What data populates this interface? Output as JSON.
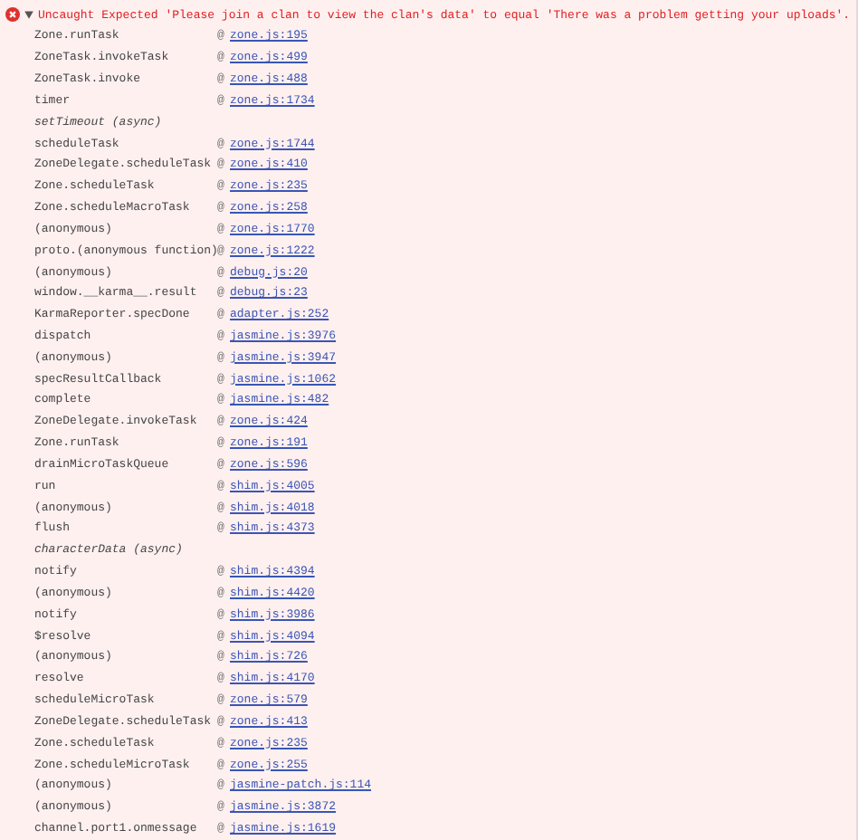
{
  "error": {
    "expanded": true,
    "message": "Uncaught Expected 'Please join a clan to view the clan's data' to equal 'There was a problem getting your uploads'.",
    "frames": [
      {
        "kind": "frame",
        "function": "Zone.runTask",
        "at": "@",
        "location": "zone.js:195"
      },
      {
        "kind": "frame",
        "function": "ZoneTask.invokeTask",
        "at": "@",
        "location": "zone.js:499"
      },
      {
        "kind": "frame",
        "function": "ZoneTask.invoke",
        "at": "@",
        "location": "zone.js:488"
      },
      {
        "kind": "frame",
        "function": "timer",
        "at": "@",
        "location": "zone.js:1734"
      },
      {
        "kind": "async",
        "label": "setTimeout (async)"
      },
      {
        "kind": "frame",
        "function": "scheduleTask",
        "at": "@",
        "location": "zone.js:1744"
      },
      {
        "kind": "frame",
        "function": "ZoneDelegate.scheduleTask",
        "at": "@",
        "location": "zone.js:410"
      },
      {
        "kind": "frame",
        "function": "Zone.scheduleTask",
        "at": "@",
        "location": "zone.js:235"
      },
      {
        "kind": "frame",
        "function": "Zone.scheduleMacroTask",
        "at": "@",
        "location": "zone.js:258"
      },
      {
        "kind": "frame",
        "function": "(anonymous)",
        "at": "@",
        "location": "zone.js:1770"
      },
      {
        "kind": "frame",
        "function": "proto.(anonymous function)",
        "at": "@",
        "location": "zone.js:1222"
      },
      {
        "kind": "frame",
        "function": "(anonymous)",
        "at": "@",
        "location": "debug.js:20"
      },
      {
        "kind": "frame",
        "function": "window.__karma__.result",
        "at": "@",
        "location": "debug.js:23"
      },
      {
        "kind": "frame",
        "function": "KarmaReporter.specDone",
        "at": "@",
        "location": "adapter.js:252"
      },
      {
        "kind": "frame",
        "function": "dispatch",
        "at": "@",
        "location": "jasmine.js:3976"
      },
      {
        "kind": "frame",
        "function": "(anonymous)",
        "at": "@",
        "location": "jasmine.js:3947"
      },
      {
        "kind": "frame",
        "function": "specResultCallback",
        "at": "@",
        "location": "jasmine.js:1062"
      },
      {
        "kind": "frame",
        "function": "complete",
        "at": "@",
        "location": "jasmine.js:482"
      },
      {
        "kind": "frame",
        "function": "ZoneDelegate.invokeTask",
        "at": "@",
        "location": "zone.js:424"
      },
      {
        "kind": "frame",
        "function": "Zone.runTask",
        "at": "@",
        "location": "zone.js:191"
      },
      {
        "kind": "frame",
        "function": "drainMicroTaskQueue",
        "at": "@",
        "location": "zone.js:596"
      },
      {
        "kind": "frame",
        "function": "run",
        "at": "@",
        "location": "shim.js:4005"
      },
      {
        "kind": "frame",
        "function": "(anonymous)",
        "at": "@",
        "location": "shim.js:4018"
      },
      {
        "kind": "frame",
        "function": "flush",
        "at": "@",
        "location": "shim.js:4373"
      },
      {
        "kind": "async",
        "label": "characterData (async)"
      },
      {
        "kind": "frame",
        "function": "notify",
        "at": "@",
        "location": "shim.js:4394"
      },
      {
        "kind": "frame",
        "function": "(anonymous)",
        "at": "@",
        "location": "shim.js:4420"
      },
      {
        "kind": "frame",
        "function": "notify",
        "at": "@",
        "location": "shim.js:3986"
      },
      {
        "kind": "frame",
        "function": "$resolve",
        "at": "@",
        "location": "shim.js:4094"
      },
      {
        "kind": "frame",
        "function": "(anonymous)",
        "at": "@",
        "location": "shim.js:726"
      },
      {
        "kind": "frame",
        "function": "resolve",
        "at": "@",
        "location": "shim.js:4170"
      },
      {
        "kind": "frame",
        "function": "scheduleMicroTask",
        "at": "@",
        "location": "zone.js:579"
      },
      {
        "kind": "frame",
        "function": "ZoneDelegate.scheduleTask",
        "at": "@",
        "location": "zone.js:413"
      },
      {
        "kind": "frame",
        "function": "Zone.scheduleTask",
        "at": "@",
        "location": "zone.js:235"
      },
      {
        "kind": "frame",
        "function": "Zone.scheduleMicroTask",
        "at": "@",
        "location": "zone.js:255"
      },
      {
        "kind": "frame",
        "function": "(anonymous)",
        "at": "@",
        "location": "jasmine-patch.js:114"
      },
      {
        "kind": "frame",
        "function": "(anonymous)",
        "at": "@",
        "location": "jasmine.js:3872"
      },
      {
        "kind": "frame",
        "function": "channel.port1.onmessage",
        "at": "@",
        "location": "jasmine.js:1619"
      }
    ]
  }
}
